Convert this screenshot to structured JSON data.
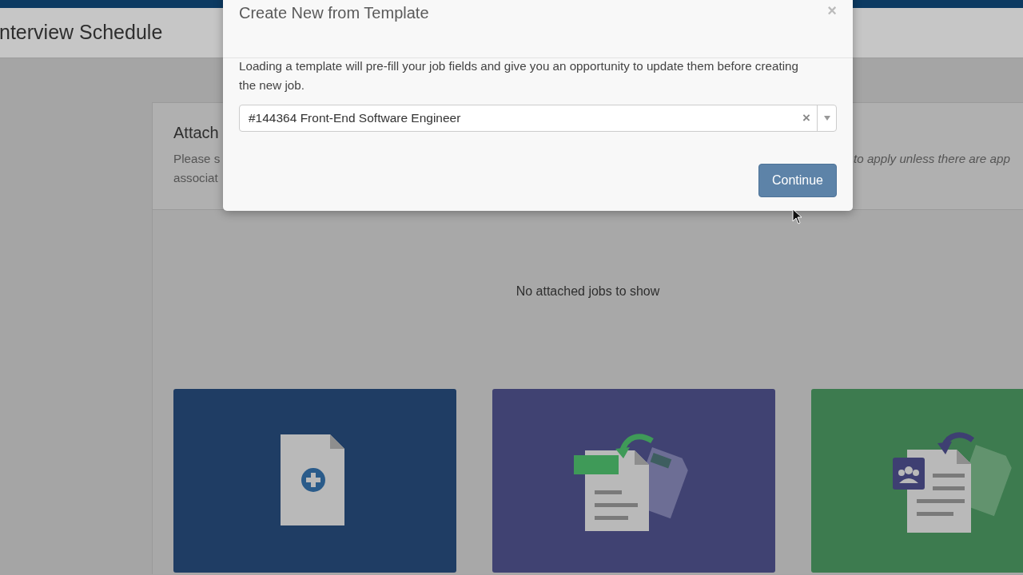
{
  "page": {
    "title": "nterview Schedule"
  },
  "card": {
    "title": "Attach",
    "description_lines": [
      "Please s",
      "associat"
    ],
    "description_right": "to apply unless there are app",
    "empty_message": "No attached jobs to show"
  },
  "tiles": [
    {
      "kind": "new",
      "color": "#1f3d64"
    },
    {
      "kind": "copy",
      "color": "#404272"
    },
    {
      "kind": "template",
      "color": "#3d7b4f"
    }
  ],
  "modal": {
    "title": "Create New from Template",
    "close": "×",
    "body": "Loading a template will pre-fill your job fields and give you an opportunity to update them before creating the new job.",
    "select": {
      "value": "#144364 Front-End Software Engineer",
      "clear": "×"
    },
    "buttons": [
      "Continue"
    ]
  }
}
